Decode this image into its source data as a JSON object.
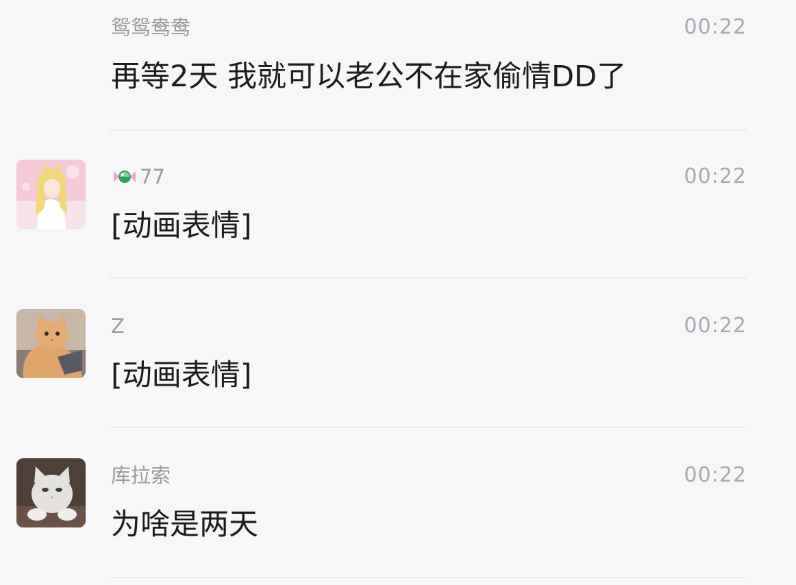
{
  "messages": [
    {
      "sender": "鸳鸳鸯鸯",
      "time": "00:22",
      "text": "再等2天 我就可以老公不在家偷情DD了",
      "avatar": "none"
    },
    {
      "sender": "77",
      "sender_icon": "candy-icon",
      "time": "00:22",
      "text": "[动画表情]",
      "avatar": "anime-girl-avatar"
    },
    {
      "sender": "Z",
      "time": "00:22",
      "text": "[动画表情]",
      "avatar": "orange-cat-avatar"
    },
    {
      "sender": "库拉索",
      "time": "00:22",
      "text": "为啥是两天",
      "avatar": "white-cat-avatar"
    }
  ],
  "colors": {
    "background": "#f7f7fa",
    "sender": "#9a9a9a",
    "time": "#a8a8ad",
    "text": "#1c1c1e",
    "divider": "#e9e9ee"
  }
}
